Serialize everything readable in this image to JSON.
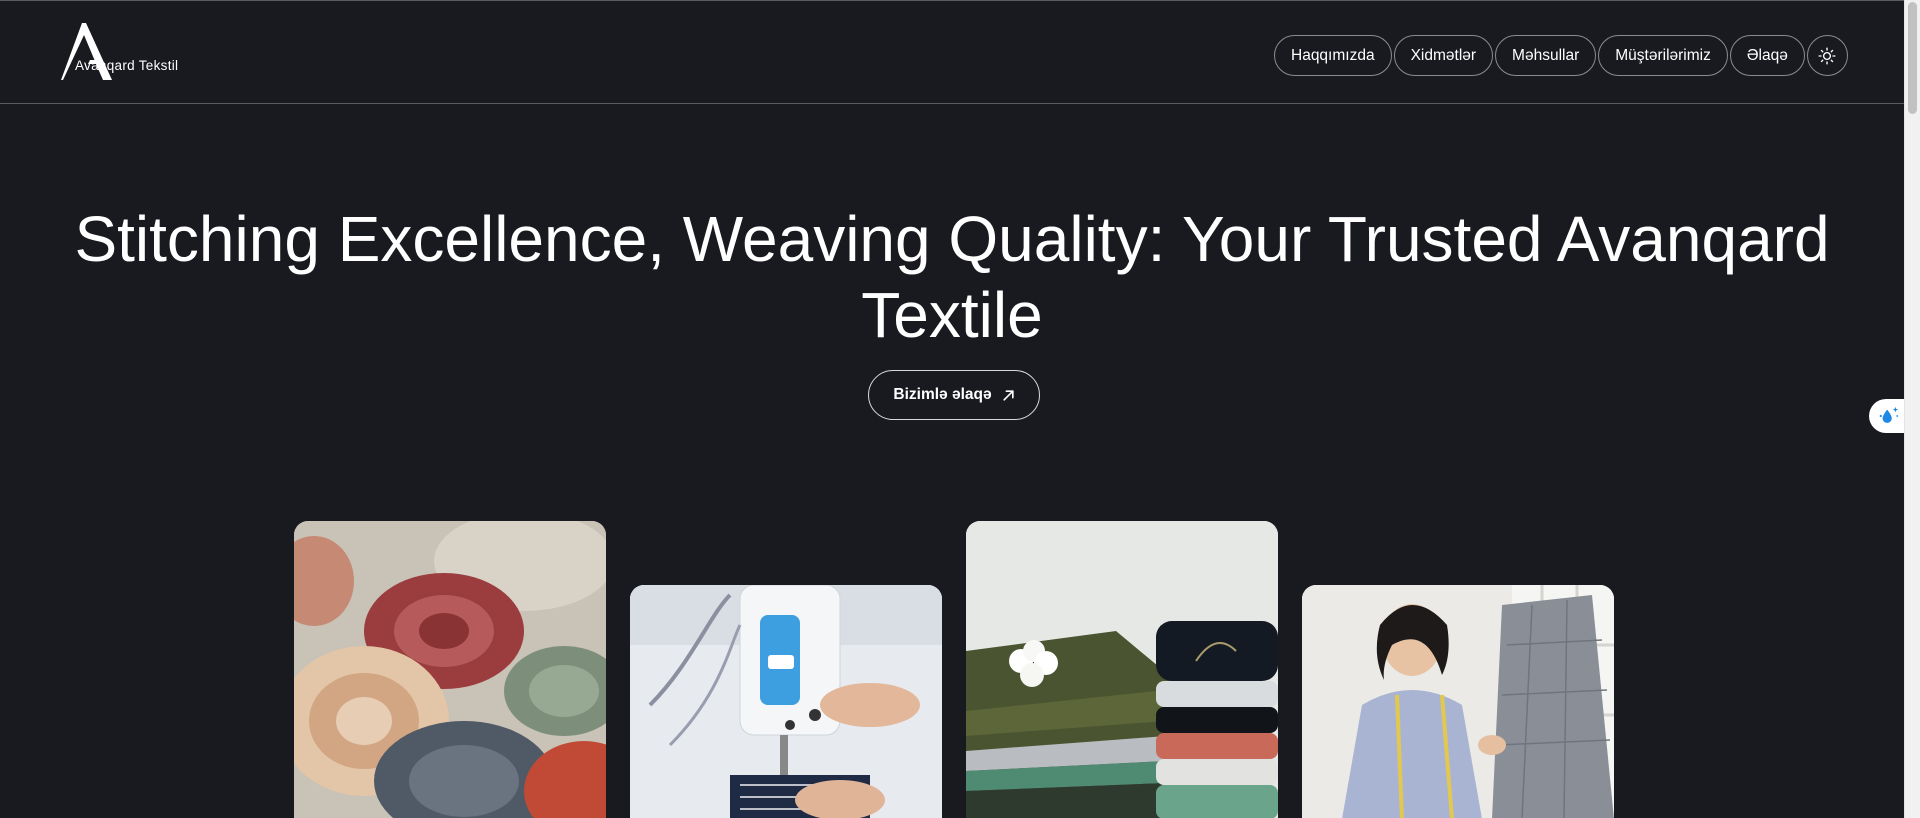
{
  "brand": {
    "name": "Avanqard Tekstil"
  },
  "nav": {
    "items": [
      {
        "label": "Haqqımızda"
      },
      {
        "label": "Xidmətlər"
      },
      {
        "label": "Məhsullar"
      },
      {
        "label": "Müştərilərimiz"
      },
      {
        "label": "Əlaqə"
      }
    ],
    "theme_toggle_icon": "sun-icon"
  },
  "hero": {
    "title": "Stitching Excellence, Weaving Quality: Your Trusted Avanqard Textile",
    "cta_label": "Bizimlə əlaqə",
    "cta_icon": "arrow-up-right-icon"
  },
  "gallery": {
    "images": [
      {
        "subject": "fabric-rolls"
      },
      {
        "subject": "sewing-machine"
      },
      {
        "subject": "folded-fabrics-with-cotton"
      },
      {
        "subject": "tailor-measuring-garment"
      }
    ]
  },
  "accessibility_widget": {
    "icon": "accessibility-icon"
  },
  "colors": {
    "background": "#191a20",
    "text": "#ffffff",
    "border": "#8b8c90"
  }
}
